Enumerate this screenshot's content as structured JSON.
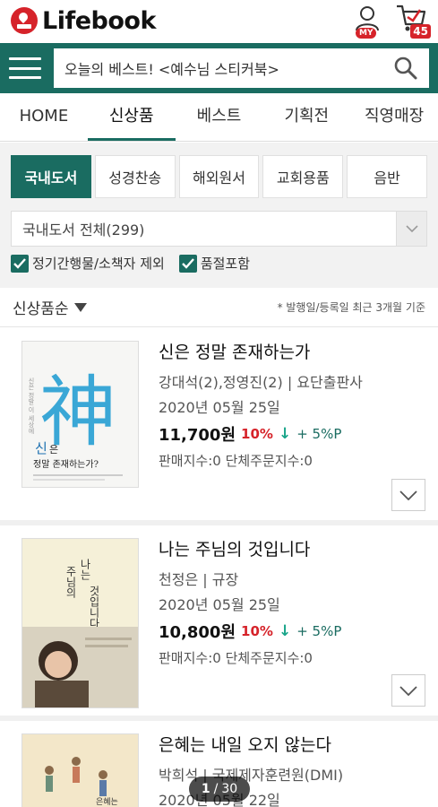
{
  "header": {
    "logo": "Lifebook",
    "my_badge": "MY",
    "cart_count": "45"
  },
  "search": {
    "value": "오늘의 베스트! <예수님 스티커북>"
  },
  "nav": {
    "tabs": [
      "HOME",
      "신상품",
      "베스트",
      "기획전",
      "직영매장"
    ],
    "active": 1
  },
  "categories": {
    "items": [
      "국내도서",
      "성경찬송",
      "해외원서",
      "교회용품",
      "음반"
    ],
    "active": 0
  },
  "select": {
    "value": "국내도서 전체(299)"
  },
  "checks": {
    "exclude_periodicals": "정기간행물/소책자 제외",
    "include_out_of_stock": "품절포함"
  },
  "sort": {
    "label": "신상품순",
    "note": "* 발행일/등록일 최근 3개월 기준"
  },
  "books": [
    {
      "title": "신은 정말 존재하는가",
      "author": "강대석(2),정영진(2) | 요단출판사",
      "date": "2020년 05월 25일",
      "price": "11,700원",
      "discount": "10%",
      "arrow": "↓",
      "point": "+ 5%P",
      "sales": "판매지수:0 단체주문지수:0",
      "cover": {
        "hanja": "神",
        "title_a": "신",
        "title_b": "은",
        "title_c": "정말 존재하는가?",
        "bg": "#f6f6f4",
        "accent": "#3aa7d6"
      }
    },
    {
      "title": "나는 주님의 것입니다",
      "author": "천정은 | 규장",
      "date": "2020년 05월 25일",
      "price": "10,800원",
      "discount": "10%",
      "arrow": "↓",
      "point": "+ 5%P",
      "sales": "판매지수:0 단체주문지수:0",
      "cover": {
        "bg": "#f5f0d8"
      }
    },
    {
      "title": "은혜는 내일 오지 않는다",
      "author": "박희석 | 국제제자훈련원(DMI)",
      "date": "2020년 05월 22일",
      "cover": {
        "bg": "#f3e7c9"
      }
    }
  ],
  "pager": {
    "current": "1",
    "sep": "/",
    "total": "30"
  }
}
